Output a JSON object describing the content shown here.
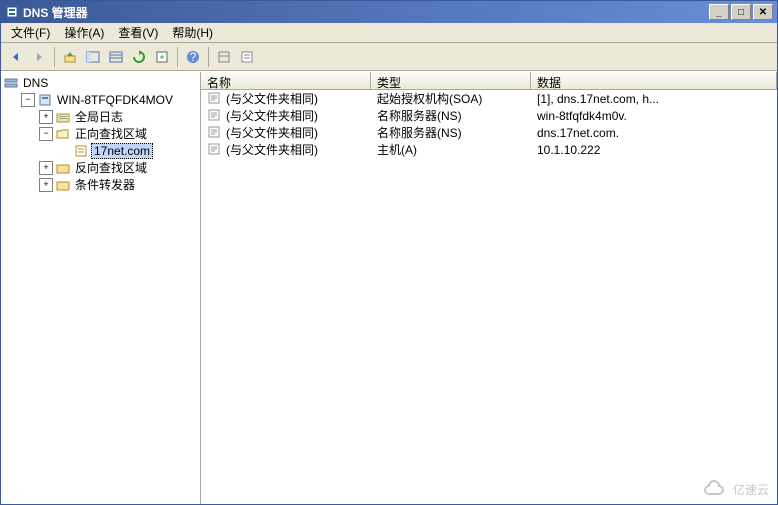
{
  "title": "DNS 管理器",
  "menu": {
    "file": "文件(F)",
    "action": "操作(A)",
    "view": "查看(V)",
    "help": "帮助(H)"
  },
  "tree": {
    "root": "DNS",
    "server": "WIN-8TFQFDK4MOV",
    "global_log": "全局日志",
    "forward_zone": "正向查找区域",
    "zone_17net": "17net.com",
    "reverse_zone": "反向查找区域",
    "conditional_fwd": "条件转发器"
  },
  "columns": {
    "name": "名称",
    "type": "类型",
    "data": "数据"
  },
  "records": [
    {
      "name": "(与父文件夹相同)",
      "type": "起始授权机构(SOA)",
      "data": "[1], dns.17net.com, h..."
    },
    {
      "name": "(与父文件夹相同)",
      "type": "名称服务器(NS)",
      "data": "win-8tfqfdk4m0v."
    },
    {
      "name": "(与父文件夹相同)",
      "type": "名称服务器(NS)",
      "data": "dns.17net.com."
    },
    {
      "name": "(与父文件夹相同)",
      "type": "主机(A)",
      "data": "10.1.10.222"
    }
  ],
  "watermark": "亿速云"
}
